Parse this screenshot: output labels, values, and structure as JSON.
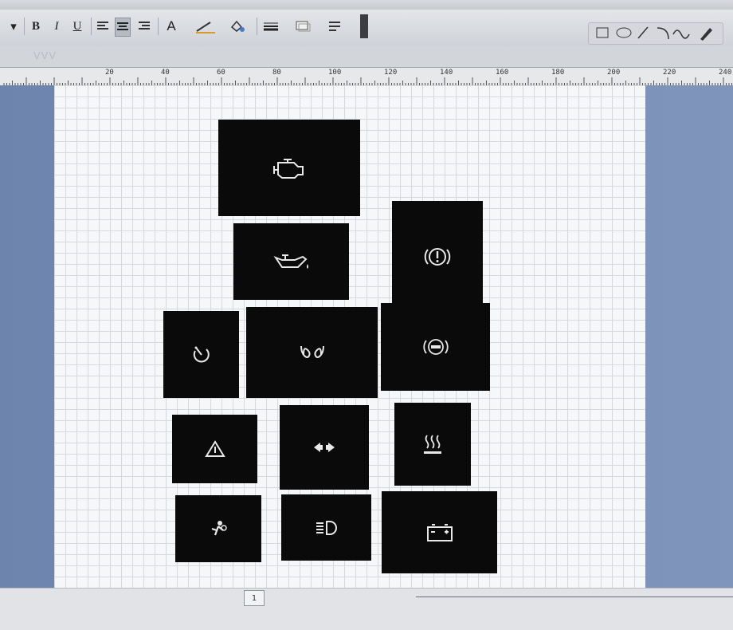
{
  "toolbar": {
    "bold_label": "B",
    "italic_label": "I",
    "underline_label": "U",
    "font_color_label": "A"
  },
  "format_strip": {
    "ghost_text": "VVV"
  },
  "ruler": {
    "ticks": [
      "20",
      "40",
      "60",
      "80",
      "100",
      "120",
      "140",
      "160",
      "180",
      "200",
      "220",
      "240"
    ]
  },
  "tiles": [
    {
      "icon": "engine-check-icon"
    },
    {
      "icon": "oil-pressure-icon"
    },
    {
      "icon": "brake-warning-icon"
    },
    {
      "icon": "tire-pressure-icon"
    },
    {
      "icon": "glow-plug-icon"
    },
    {
      "icon": "abs-icon"
    },
    {
      "icon": "hazard-triangle-icon"
    },
    {
      "icon": "turn-signal-icon"
    },
    {
      "icon": "rear-defrost-icon"
    },
    {
      "icon": "airbag-icon"
    },
    {
      "icon": "headlight-icon"
    },
    {
      "icon": "battery-icon"
    }
  ],
  "colors": {
    "tile": "#0a0a0a",
    "icon": "#e8e8e8",
    "workspace": "#7389b0"
  },
  "bottom": {
    "page_marker": "1"
  }
}
